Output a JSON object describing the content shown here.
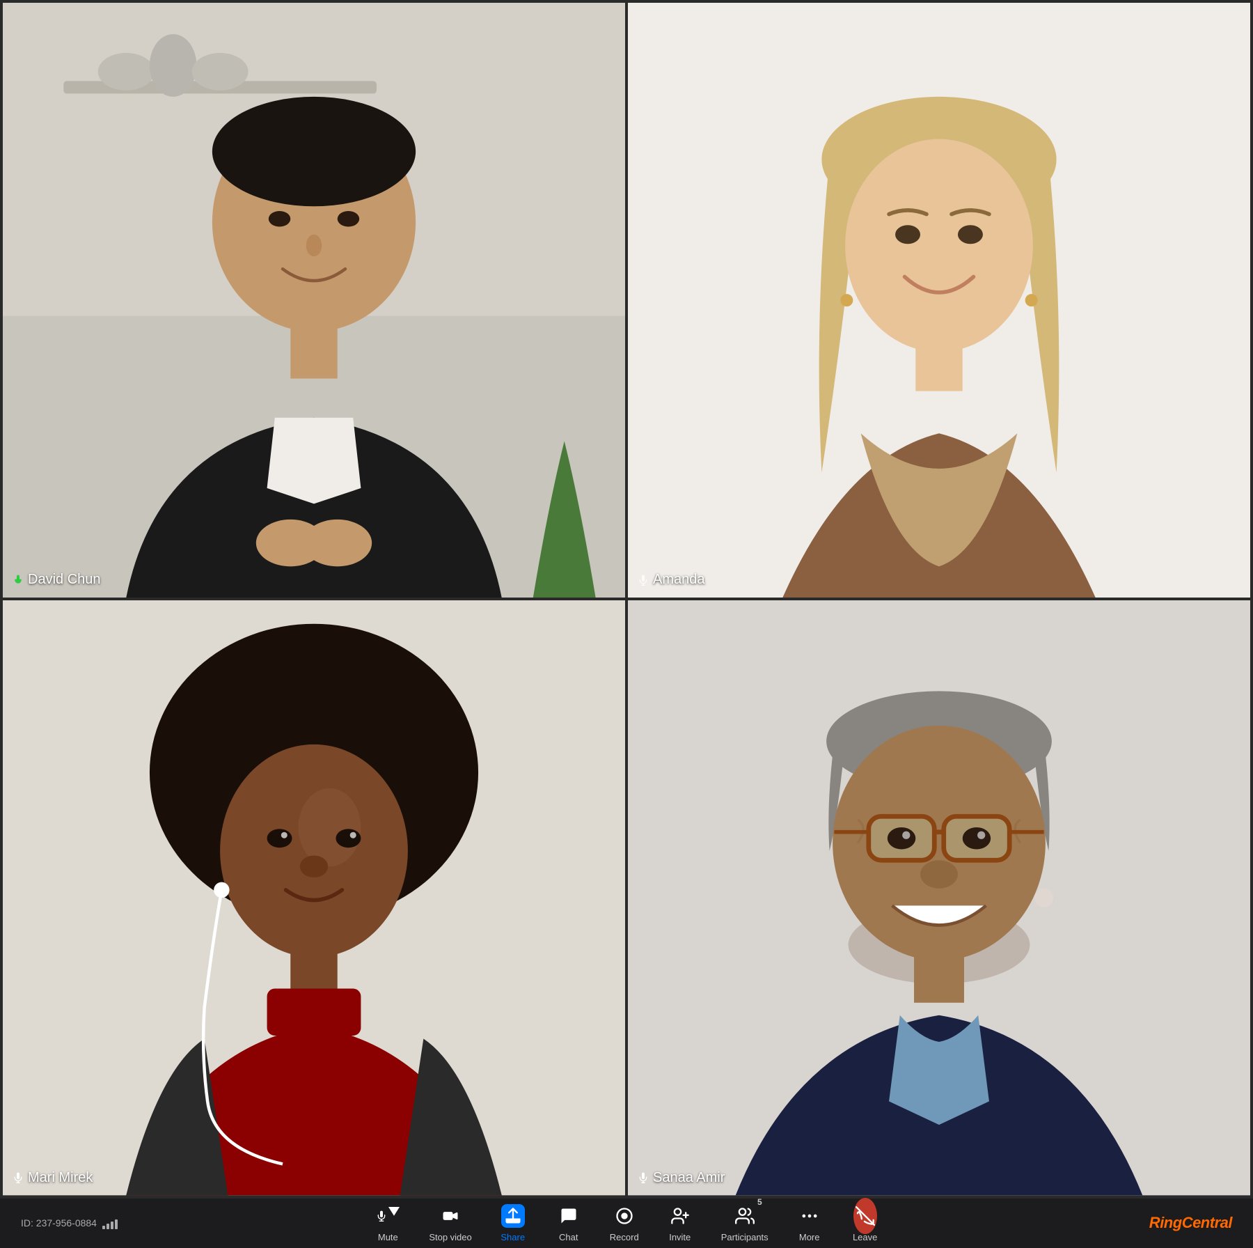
{
  "meeting": {
    "id": "ID: 237-956-0884",
    "signal_bars": [
      4,
      7,
      10,
      13,
      16
    ]
  },
  "participants": [
    {
      "id": "david-chun",
      "name": "David Chun",
      "mic_active": true,
      "active_speaker": true,
      "position": "top-left"
    },
    {
      "id": "amanda",
      "name": "Amanda",
      "mic_active": false,
      "active_speaker": false,
      "position": "top-right"
    },
    {
      "id": "mari-mirek",
      "name": "Mari Mirek",
      "mic_active": true,
      "active_speaker": false,
      "position": "bottom-left"
    },
    {
      "id": "sanaa-amir",
      "name": "Sanaa Amir",
      "mic_active": true,
      "active_speaker": false,
      "position": "bottom-right"
    }
  ],
  "toolbar": {
    "buttons": [
      {
        "id": "mute",
        "label": "Mute",
        "has_arrow": true
      },
      {
        "id": "stop-video",
        "label": "Stop video"
      },
      {
        "id": "share",
        "label": "Share",
        "highlighted": true
      },
      {
        "id": "chat",
        "label": "Chat"
      },
      {
        "id": "record",
        "label": "Record"
      },
      {
        "id": "invite",
        "label": "Invite"
      },
      {
        "id": "participants",
        "label": "Participants",
        "count": "5"
      },
      {
        "id": "more",
        "label": "More"
      },
      {
        "id": "leave",
        "label": "Leave"
      }
    ]
  },
  "logo": {
    "text_ring": "Ring",
    "text_central": "Central"
  }
}
